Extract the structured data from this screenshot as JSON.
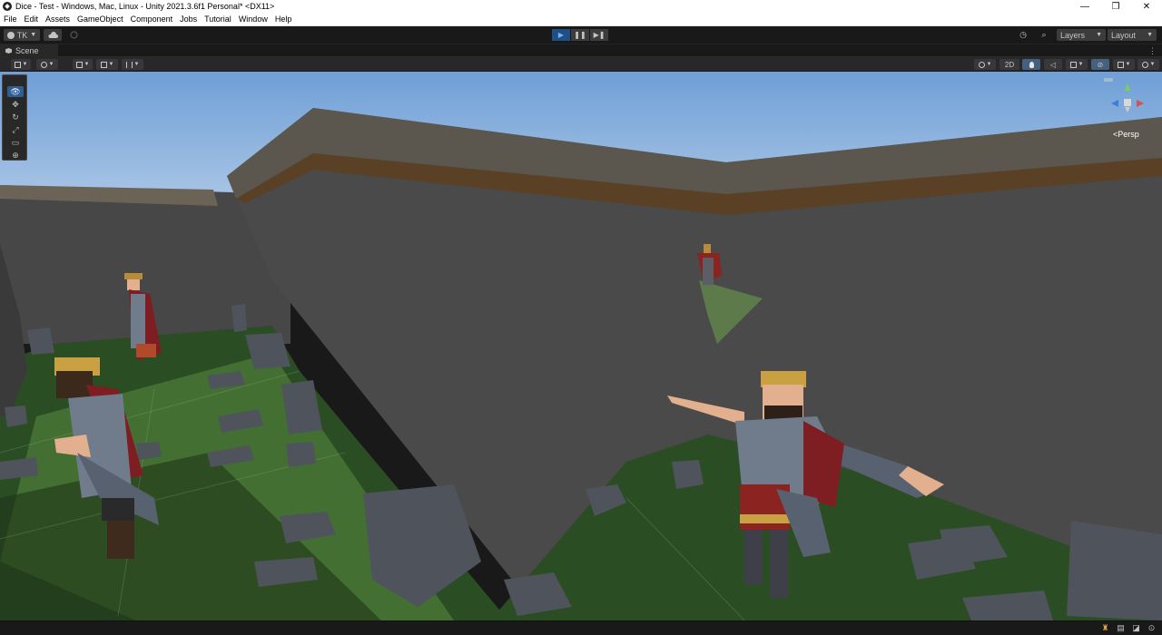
{
  "window": {
    "title": "Dice - Test - Windows, Mac, Linux - Unity 2021.3.6f1 Personal* <DX11>",
    "minimize": "—",
    "restore": "❐",
    "close": "✕"
  },
  "menu": [
    "File",
    "Edit",
    "Assets",
    "GameObject",
    "Component",
    "Jobs",
    "Tutorial",
    "Window",
    "Help"
  ],
  "toolbar": {
    "account": "TK",
    "play_icon": "▶",
    "pause_icon": "❚❚",
    "step_icon": "▶❚",
    "history_icon": "◷",
    "search_icon": "⌕",
    "layers": "Layers",
    "layout": "Layout"
  },
  "scene": {
    "tab_label": "Scene",
    "toolbar": {
      "two_d": "2D"
    },
    "gizmo_label": "Persp",
    "tools": [
      {
        "name": "view-tool",
        "icon": "👁"
      },
      {
        "name": "move-tool",
        "icon": "✥"
      },
      {
        "name": "rotate-tool",
        "icon": "↻"
      },
      {
        "name": "scale-tool",
        "icon": "⤢"
      },
      {
        "name": "rect-tool",
        "icon": "▭"
      },
      {
        "name": "transform-tool",
        "icon": "⊕"
      }
    ]
  },
  "colors": {
    "accent": "#2f5e93",
    "play_active": "#1f4f83",
    "sky_top": "#6f9fd6",
    "sky_bottom": "#c1d5ec",
    "ground": "#2a4d23",
    "wall": "#4a4a4a"
  }
}
